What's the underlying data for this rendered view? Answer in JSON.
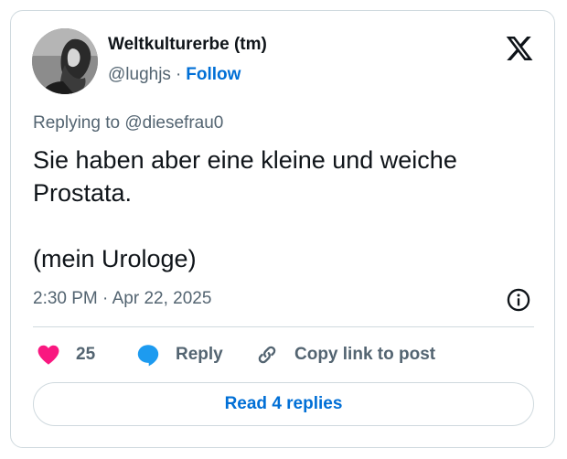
{
  "author": {
    "display_name": "Weltkulturerbe (tm)",
    "handle": "@lughjs",
    "separator": "·",
    "follow_label": "Follow"
  },
  "reply_context": "Replying to @diesefrau0",
  "tweet": {
    "line1": "Sie haben aber eine kleine und weiche Prostata.",
    "line2": "(mein Urologe)"
  },
  "timestamp": "2:30 PM · Apr 22, 2025",
  "actions": {
    "like_count": "25",
    "reply_label": "Reply",
    "copy_link_label": "Copy link to post"
  },
  "read_replies_label": "Read 4 replies",
  "icons": {
    "logo": "x-logo-icon",
    "info": "info-icon",
    "like": "heart-icon",
    "reply": "speech-bubble-icon",
    "copy": "link-icon"
  },
  "colors": {
    "link": "#006fd6",
    "like": "#f91880",
    "reply": "#1d9bf0",
    "secondary_text": "#536471",
    "border": "#cfd9de"
  }
}
